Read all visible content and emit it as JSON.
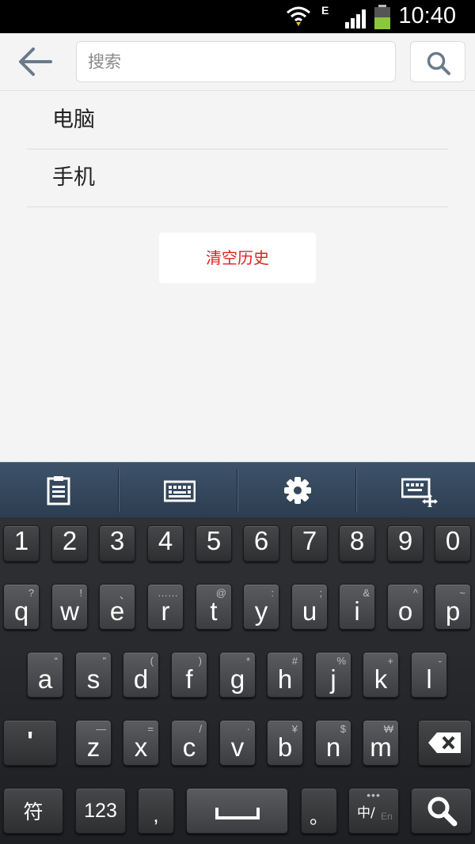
{
  "status_bar": {
    "time": "10:40",
    "network_type": "E",
    "icons": [
      "wifi-icon",
      "signal-icon",
      "battery-icon"
    ]
  },
  "search": {
    "placeholder": "搜索",
    "value": ""
  },
  "history": {
    "items": [
      "电脑",
      "手机"
    ],
    "clear_label": "清空历史"
  },
  "keyboard": {
    "toolbar_icons": [
      "clipboard-icon",
      "keyboard-icon",
      "settings-gear-icon",
      "keyboard-resize-icon"
    ],
    "number_row": [
      "1",
      "2",
      "3",
      "4",
      "5",
      "6",
      "7",
      "8",
      "9",
      "0"
    ],
    "row1": [
      {
        "main": "q",
        "sub": "?"
      },
      {
        "main": "w",
        "sub": "!"
      },
      {
        "main": "e",
        "sub": "、"
      },
      {
        "main": "r",
        "sub": "……"
      },
      {
        "main": "t",
        "sub": "@"
      },
      {
        "main": "y",
        "sub": ":"
      },
      {
        "main": "u",
        "sub": ";"
      },
      {
        "main": "i",
        "sub": "&"
      },
      {
        "main": "o",
        "sub": "^"
      },
      {
        "main": "p",
        "sub": "~"
      }
    ],
    "row2": [
      {
        "main": "a",
        "sub": "“"
      },
      {
        "main": "s",
        "sub": "”"
      },
      {
        "main": "d",
        "sub": "("
      },
      {
        "main": "f",
        "sub": ")"
      },
      {
        "main": "g",
        "sub": "*"
      },
      {
        "main": "h",
        "sub": "#"
      },
      {
        "main": "j",
        "sub": "%"
      },
      {
        "main": "k",
        "sub": "+"
      },
      {
        "main": "l",
        "sub": "-"
      }
    ],
    "row3": [
      {
        "main": "z",
        "sub": "—"
      },
      {
        "main": "x",
        "sub": "="
      },
      {
        "main": "c",
        "sub": "/"
      },
      {
        "main": "v",
        "sub": "·"
      },
      {
        "main": "b",
        "sub": "¥"
      },
      {
        "main": "n",
        "sub": "$"
      },
      {
        "main": "m",
        "sub": "₩"
      }
    ],
    "apostrophe": "'",
    "symbols_key": "符",
    "numbers_key": "123",
    "comma": ",",
    "period": "。",
    "lang_key_main": "中/",
    "lang_key_sub": "En"
  }
}
